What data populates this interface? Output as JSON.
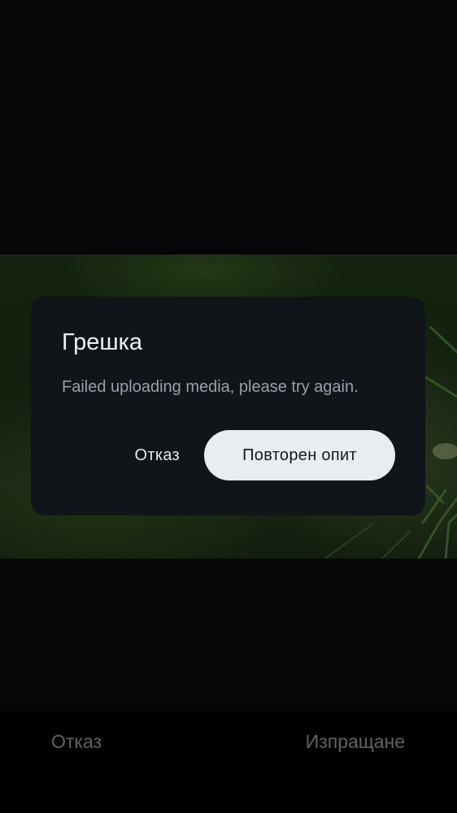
{
  "dialog": {
    "title": "Грешка",
    "message": "Failed uploading media, please try again.",
    "cancel_label": "Отказ",
    "retry_label": "Повторен опит"
  },
  "bottom_bar": {
    "cancel_label": "Отказ",
    "send_label": "Изпращане"
  },
  "colors": {
    "background": "#07090c",
    "dialog_surface": "#111419",
    "primary_button": "#e9ecf1",
    "bottom_bar_text": "#5f6266"
  }
}
